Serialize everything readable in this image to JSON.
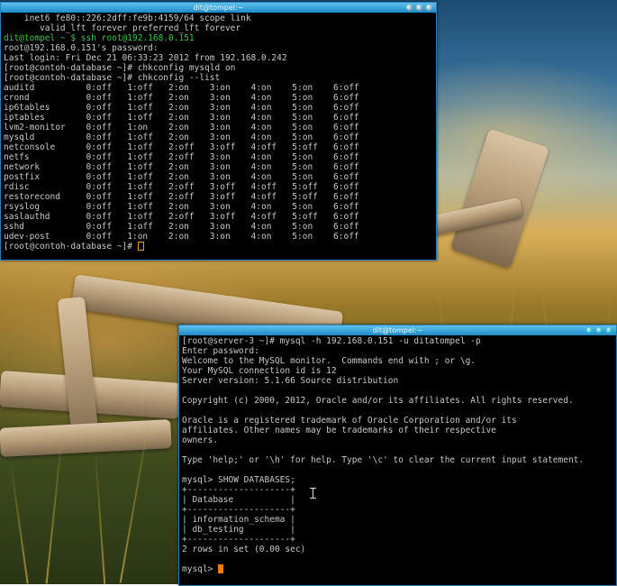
{
  "terminal1": {
    "title": "dit@tompel:~",
    "lines": [
      {
        "text": "    inet6 fe80::226:2dff:fe9b:4159/64 scope link",
        "color": "#c9c9c9"
      },
      {
        "text": "       valid_lft forever preferred_lft forever",
        "color": "#c9c9c9"
      },
      {
        "text": "dit@tompel ~ $ ssh root@192.168.0.151",
        "color": "#3cc94a"
      },
      {
        "text": "root@192.168.0.151's password:",
        "color": "#c9c9c9"
      },
      {
        "text": "Last login: Fri Dec 21 06:33:23 2012 from 192.168.0.242",
        "color": "#c9c9c9"
      },
      {
        "text": "[root@contoh-database ~]# chkconfig mysqld on",
        "color": "#c9c9c9"
      },
      {
        "text": "[root@contoh-database ~]# chkconfig --list",
        "color": "#c9c9c9"
      },
      {
        "text": "auditd          0:off   1:off   2:on    3:on    4:on    5:on    6:off",
        "color": "#c9c9c9"
      },
      {
        "text": "crond           0:off   1:off   2:on    3:on    4:on    5:on    6:off",
        "color": "#c9c9c9"
      },
      {
        "text": "ip6tables       0:off   1:off   2:on    3:on    4:on    5:on    6:off",
        "color": "#c9c9c9"
      },
      {
        "text": "iptables        0:off   1:off   2:on    3:on    4:on    5:on    6:off",
        "color": "#c9c9c9"
      },
      {
        "text": "lvm2-monitor    0:off   1:on    2:on    3:on    4:on    5:on    6:off",
        "color": "#c9c9c9"
      },
      {
        "text": "mysqld          0:off   1:off   2:on    3:on    4:on    5:on    6:off",
        "color": "#c9c9c9"
      },
      {
        "text": "netconsole      0:off   1:off   2:off   3:off   4:off   5:off   6:off",
        "color": "#c9c9c9"
      },
      {
        "text": "netfs           0:off   1:off   2:off   3:on    4:on    5:on    6:off",
        "color": "#c9c9c9"
      },
      {
        "text": "network         0:off   1:off   2:on    3:on    4:on    5:on    6:off",
        "color": "#c9c9c9"
      },
      {
        "text": "postfix         0:off   1:off   2:on    3:on    4:on    5:on    6:off",
        "color": "#c9c9c9"
      },
      {
        "text": "rdisc           0:off   1:off   2:off   3:off   4:off   5:off   6:off",
        "color": "#c9c9c9"
      },
      {
        "text": "restorecond     0:off   1:off   2:off   3:off   4:off   5:off   6:off",
        "color": "#c9c9c9"
      },
      {
        "text": "rsyslog         0:off   1:off   2:on    3:on    4:on    5:on    6:off",
        "color": "#c9c9c9"
      },
      {
        "text": "saslauthd       0:off   1:off   2:off   3:off   4:off   5:off   6:off",
        "color": "#c9c9c9"
      },
      {
        "text": "sshd            0:off   1:off   2:on    3:on    4:on    5:on    6:off",
        "color": "#c9c9c9"
      },
      {
        "text": "udev-post       0:off   1:on    2:on    3:on    4:on    5:on    6:off",
        "color": "#c9c9c9"
      }
    ],
    "prompt": "[root@contoh-database ~]# "
  },
  "terminal2": {
    "title": "dit@tompel:~",
    "lines": [
      {
        "text": "[root@server-3 ~]# mysql -h 192.168.0.151 -u ditatompel -p"
      },
      {
        "text": "Enter password:"
      },
      {
        "text": "Welcome to the MySQL monitor.  Commands end with ; or \\g."
      },
      {
        "text": "Your MySQL connection id is 12"
      },
      {
        "text": "Server version: 5.1.66 Source distribution"
      },
      {
        "text": ""
      },
      {
        "text": "Copyright (c) 2000, 2012, Oracle and/or its affiliates. All rights reserved."
      },
      {
        "text": ""
      },
      {
        "text": "Oracle is a registered trademark of Oracle Corporation and/or its"
      },
      {
        "text": "affiliates. Other names may be trademarks of their respective"
      },
      {
        "text": "owners."
      },
      {
        "text": ""
      },
      {
        "text": "Type 'help;' or '\\h' for help. Type '\\c' to clear the current input statement."
      },
      {
        "text": ""
      },
      {
        "text": "mysql> SHOW DATABASES;"
      },
      {
        "text": "+--------------------+"
      },
      {
        "text": "| Database           |"
      },
      {
        "text": "+--------------------+"
      },
      {
        "text": "| information_schema |"
      },
      {
        "text": "| db_testing         |"
      },
      {
        "text": "+--------------------+"
      },
      {
        "text": "2 rows in set (0.00 sec)"
      },
      {
        "text": ""
      }
    ],
    "prompt": "mysql> "
  },
  "colors": {
    "titlebar": "#2aa0dc",
    "prompt_green": "#3cc94a",
    "cursor_orange": "#f07a10"
  }
}
